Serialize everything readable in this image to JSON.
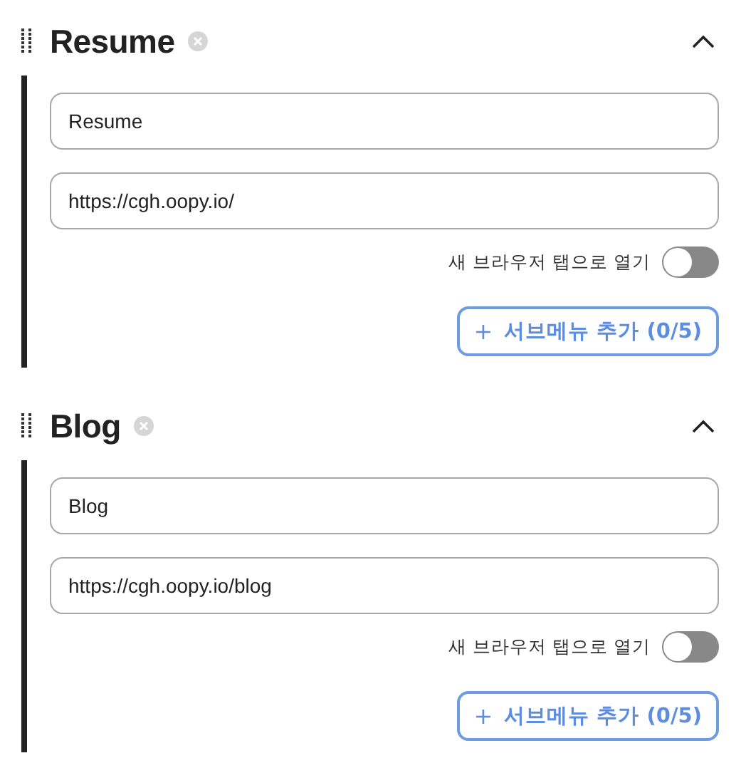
{
  "menu_items": [
    {
      "title": "Resume",
      "expanded": true,
      "name_value": "Resume",
      "url_value": "https://cgh.oopy.io/",
      "new_tab_label": "새 브라우저 탭으로 열기",
      "new_tab_on": false,
      "add_button": {
        "icon": "+",
        "label": "서브메뉴 추가 (0/5)"
      }
    },
    {
      "title": "Blog",
      "expanded": true,
      "name_value": "Blog",
      "url_value": "https://cgh.oopy.io/blog",
      "new_tab_label": "새 브라우저 탭으로 열기",
      "new_tab_on": false,
      "add_button": {
        "icon": "+",
        "label": "서브메뉴 추가 (0/5)"
      }
    }
  ]
}
